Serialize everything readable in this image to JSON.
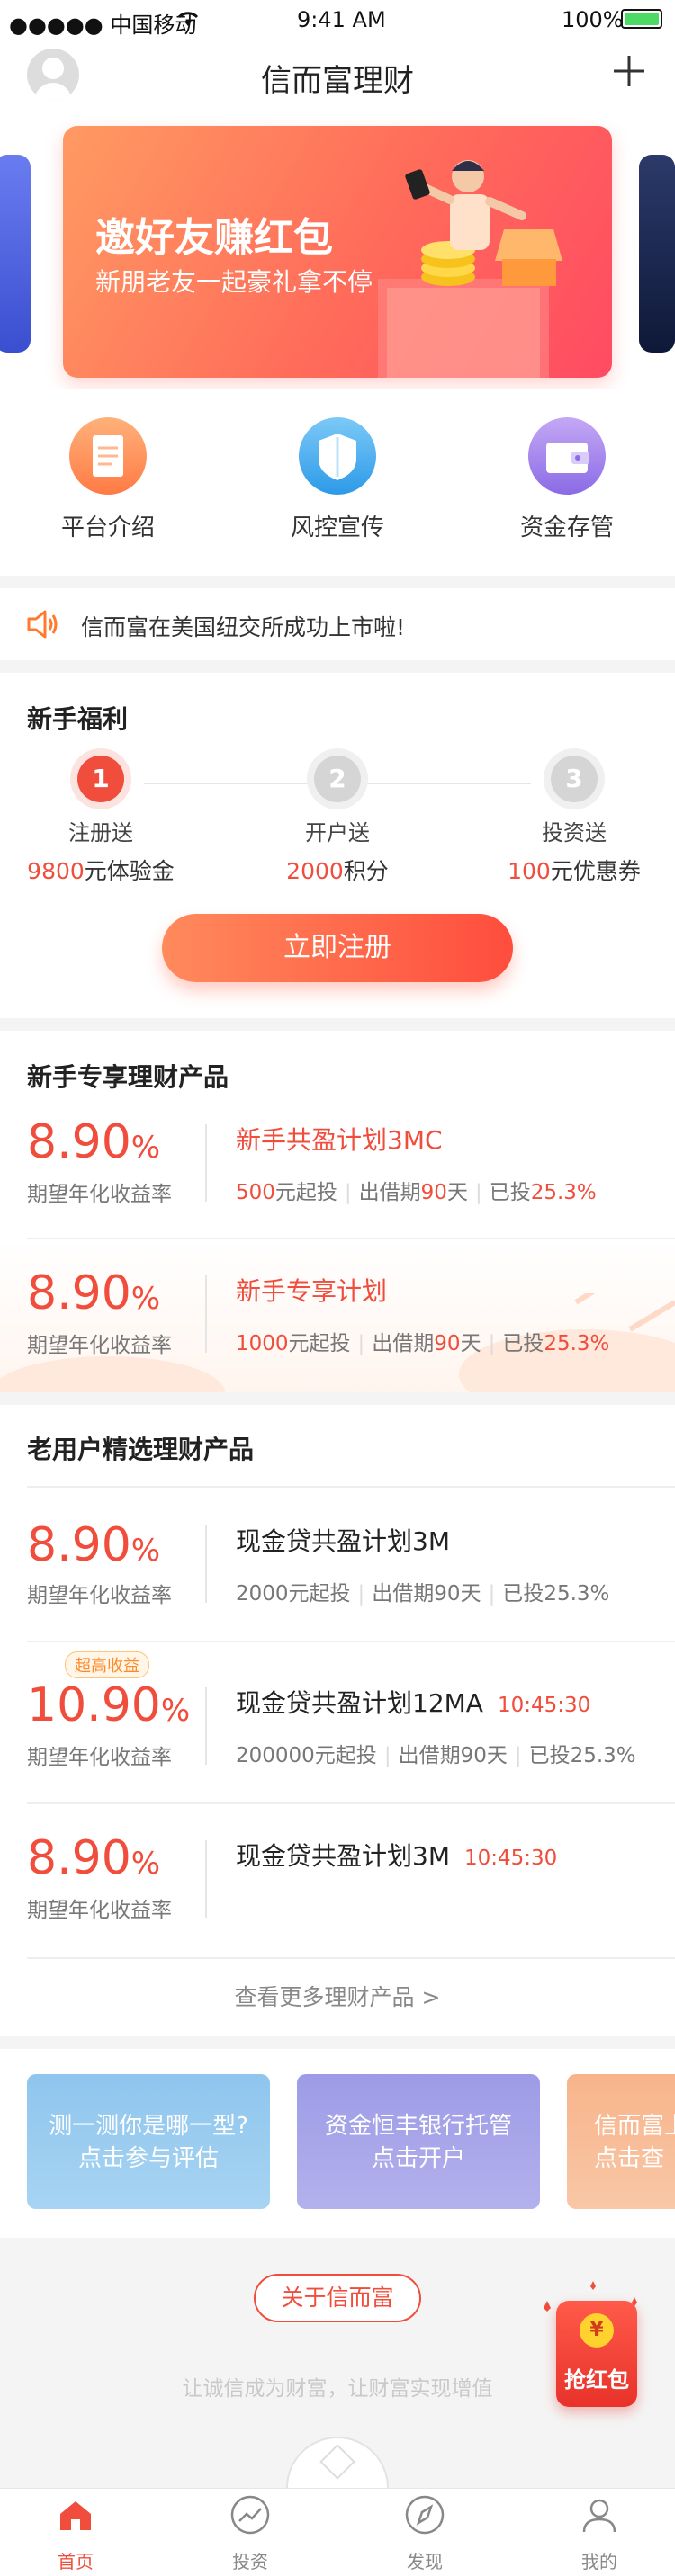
{
  "status_bar": {
    "carrier": "●●●●● 中国移动",
    "time": "9:41 AM",
    "battery": "100%"
  },
  "header": {
    "title": "信而富理财",
    "add_icon": "plus-icon"
  },
  "banner": {
    "title": "邀好友赚红包",
    "subtitle": "新朋老友一起豪礼拿不停"
  },
  "quick_links": [
    {
      "label": "平台介绍",
      "icon": "document-icon"
    },
    {
      "label": "风控宣传",
      "icon": "shield-icon"
    },
    {
      "label": "资金存管",
      "icon": "wallet-icon"
    }
  ],
  "notice": {
    "text": "信而富在美国纽交所成功上市啦!",
    "icon": "speaker-icon"
  },
  "newbie": {
    "title": "新手福利",
    "steps": [
      {
        "num": "1",
        "name": "注册送",
        "amount": "9800",
        "unit": "元体验金"
      },
      {
        "num": "2",
        "name": "开户送",
        "amount": "2000",
        "unit": "积分"
      },
      {
        "num": "3",
        "name": "投资送",
        "amount": "100",
        "unit": "元优惠券"
      }
    ],
    "register_button": "立即注册"
  },
  "newbie_products": {
    "title": "新手专享理财产品",
    "items": [
      {
        "rate": "8.90",
        "pct": "%",
        "rate_label": "期望年化收益率",
        "name": "新手共盈计划3MC",
        "min": "500",
        "min_unit": "元起投",
        "period_label": "出借期",
        "period": "90",
        "period_unit": "天",
        "invested_label": "已投",
        "invested": "25.3%"
      },
      {
        "rate": "8.90",
        "pct": "%",
        "rate_label": "期望年化收益率",
        "name": "新手专享计划",
        "min": "1000",
        "min_unit": "元起投",
        "period_label": "出借期",
        "period": "90",
        "period_unit": "天",
        "invested_label": "已投",
        "invested": "25.3%"
      }
    ]
  },
  "old_products": {
    "title": "老用户精选理财产品",
    "items": [
      {
        "rate": "8.90",
        "pct": "%",
        "rate_label": "期望年化收益率",
        "name": "现金贷共盈计划3M",
        "time": "",
        "badge": "",
        "meta": [
          "2000元起投",
          "出借期90天",
          "已投25.3%"
        ]
      },
      {
        "rate": "10.90",
        "pct": "%",
        "rate_label": "期望年化收益率",
        "name": "现金贷共盈计划12MA",
        "time": "10:45:30",
        "badge": "超高收益",
        "meta": [
          "200000元起投",
          "出借期90天",
          "已投25.3%"
        ]
      },
      {
        "rate": "8.90",
        "pct": "%",
        "rate_label": "期望年化收益率",
        "name": "现金贷共盈计划3M",
        "time": "10:45:30",
        "badge": "",
        "meta": []
      }
    ],
    "more_link": "查看更多理财产品 >"
  },
  "promos": [
    {
      "line1": "测一测你是哪一型?",
      "line2": "点击参与评估"
    },
    {
      "line1": "资金恒丰银行托管",
      "line2": "点击开户"
    },
    {
      "line1": "信而富上",
      "line2": "点击查"
    }
  ],
  "footer": {
    "about_button": "关于信而富",
    "slogan": "让诚信成为财富，让财富实现增值"
  },
  "red_packet": {
    "coin": "¥",
    "label": "抢红包"
  },
  "tabs": [
    {
      "label": "首页",
      "icon": "home-icon",
      "active": true
    },
    {
      "label": "投资",
      "icon": "chart-icon",
      "active": false
    },
    {
      "label": "发现",
      "icon": "compass-icon",
      "active": false
    },
    {
      "label": "我的",
      "icon": "user-icon",
      "active": false
    }
  ],
  "colors": {
    "accent": "#f04d3c",
    "orange": "#ff7a45",
    "promo_blue": "#8fc5ee",
    "promo_purple": "#9d9be6",
    "promo_orange": "#f7b48b"
  }
}
